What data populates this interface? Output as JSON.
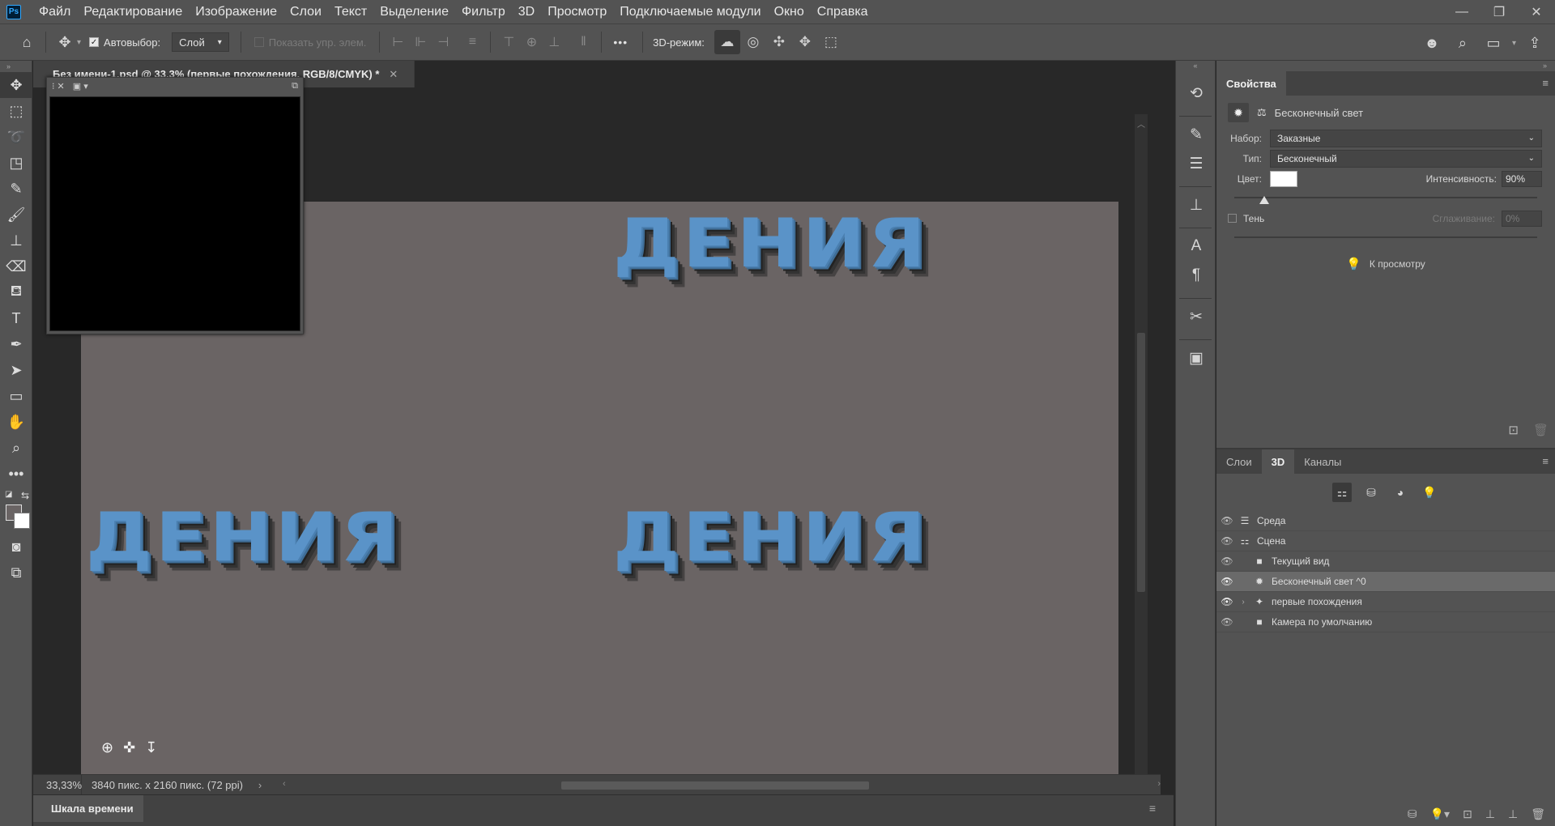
{
  "app": {
    "logo": "Ps"
  },
  "menubar": {
    "items": [
      "Файл",
      "Редактирование",
      "Изображение",
      "Слои",
      "Текст",
      "Выделение",
      "Фильтр",
      "3D",
      "Просмотр",
      "Подключаемые модули",
      "Окно",
      "Справка"
    ],
    "window_controls": {
      "minimize": "—",
      "restore": "❐",
      "close": "✕"
    }
  },
  "optbar": {
    "autoselect_label": "Автовыбор:",
    "autoselect_checked": true,
    "autoselect_target": "Слой",
    "show_transform_label": "Показать упр. элем.",
    "more": "•••",
    "mode3d_label": "3D-режим:"
  },
  "document": {
    "tab_title": "Без имени-1.psd @ 33,3% (первые похождения, RGB/8/CMYK) *",
    "tab_close": "✕",
    "canvas_color": "#6a6464",
    "text_color": "#5a93c8",
    "title_text": "ДЕНИЯ"
  },
  "statusbar": {
    "zoom": "33,33%",
    "doc_info": "3840 пикс. x 2160 пикс. (72 ppi)",
    "arrow": "›"
  },
  "timeline": {
    "label": "Шкала времени"
  },
  "properties": {
    "tab": "Свойства",
    "header_label": "Бесконечный свет",
    "preset_label": "Набор:",
    "preset_value": "Заказные",
    "type_label": "Тип:",
    "type_value": "Бесконечный",
    "color_label": "Цвет:",
    "color_value": "#ffffff",
    "intensity_label": "Интенсивность:",
    "intensity_value": "90%",
    "intensity_fraction": 0.9,
    "shadow_label": "Тень",
    "softness_label": "Сглаживание:",
    "softness_value": "0%",
    "move_to_view": "К просмотру"
  },
  "layers_panel": {
    "tabs": [
      "Слои",
      "3D",
      "Каналы"
    ],
    "active_tab": "3D",
    "rows": [
      {
        "label": "Среда",
        "icon": "environment-icon",
        "glyph": "☰"
      },
      {
        "label": "Сцена",
        "icon": "scene-icon",
        "glyph": "⚏"
      },
      {
        "label": "Текущий вид",
        "icon": "camera-icon",
        "glyph": "■"
      },
      {
        "label": "Бесконечный свет ^0",
        "icon": "infinite-light-icon",
        "glyph": "✹",
        "selected": true
      },
      {
        "label": "первые похождения",
        "icon": "mesh-icon",
        "glyph": "✦",
        "expandable": true
      },
      {
        "label": "Камера по умолчанию",
        "icon": "camera-icon",
        "glyph": "■"
      }
    ]
  }
}
